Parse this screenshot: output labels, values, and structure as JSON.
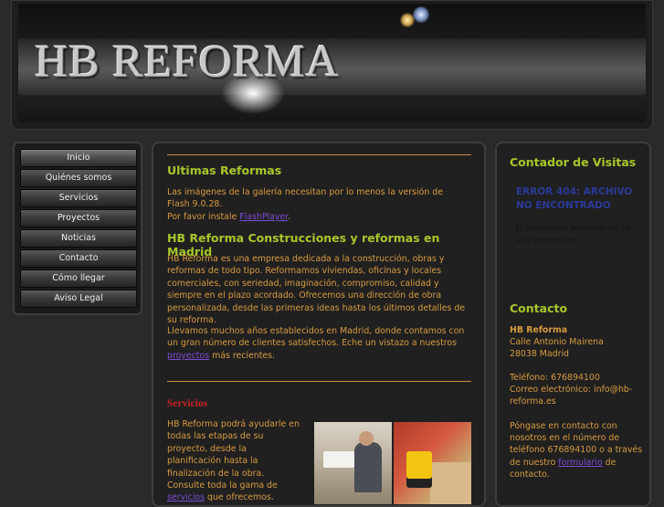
{
  "header": {
    "title": "HB REFORMA"
  },
  "nav": {
    "items": [
      {
        "label": "Inicio"
      },
      {
        "label": "Quiénes somos"
      },
      {
        "label": "Servicios"
      },
      {
        "label": "Proyectos"
      },
      {
        "label": "Noticias"
      },
      {
        "label": "Contacto"
      },
      {
        "label": "Cómo llegar"
      },
      {
        "label": "Aviso Legal"
      }
    ]
  },
  "main": {
    "gallery_heading": "Ultimas Reformas",
    "flash_notice": "Las imágenes de la galería necesitan por lo menos la versión de Flash 9.0.28.",
    "flash_install_prefix": "Por favor instale ",
    "flash_link": "FlashPlayer",
    "flash_install_suffix": ".",
    "company_heading": "HB Reforma Construcciones y reformas en Madrid",
    "intro_paragraph": "HB Reforma es una empresa dedicada a la construcción, obras y reformas de todo tipo. Reformamos viviendas, oficinas y locales comerciales, con seriedad, imaginación, compromiso, calidad y siempre en el plazo acordado. Ofrecemos una dirección de obra personalizada, desde las primeras ideas hasta los últimos detalles de su reforma.",
    "clients_paragraph_prefix": "Llevamos muchos años establecidos en Madrid, donde contamos con un gran número de clientes satisfechos. Eche un vistazo a nuestros ",
    "clients_link": "proyectos",
    "clients_paragraph_suffix": " más recientes.",
    "services_heading": "Servicios",
    "services_paragraph_prefix": "HB Reforma podrá ayudarle en todas las etapas de su proyecto, desde la planificación hasta la finalización de la obra. Consulte toda la gama de ",
    "services_link": "servicios",
    "services_paragraph_suffix": " que ofrecemos."
  },
  "sidebar_right": {
    "counter_heading": "Contador de Visitas",
    "error_title": "ERROR 404: ARCHIVO NO ENCONTRADO",
    "error_text": "El documento solicitado no ha sido encontrado.",
    "contact_heading": "Contacto",
    "company_name": "HB Reforma",
    "address_line1": "Calle Antonio Mairena",
    "address_line2": "28038 Madrid",
    "phone_line": "Teléfono: 676894100",
    "email_line": "Correo electrónico: info@hb-reforma.es",
    "contact_paragraph_prefix": "Póngase en contacto con nosotros en el número de teléfono 676894100 o a través de nuestro ",
    "contact_link": "formulario",
    "contact_paragraph_suffix": " de contacto."
  },
  "colors": {
    "accent_green": "#a8c72a",
    "text_orange": "#d89b3f",
    "link_purple": "#7b4cd4",
    "services_red": "#cc2222"
  }
}
